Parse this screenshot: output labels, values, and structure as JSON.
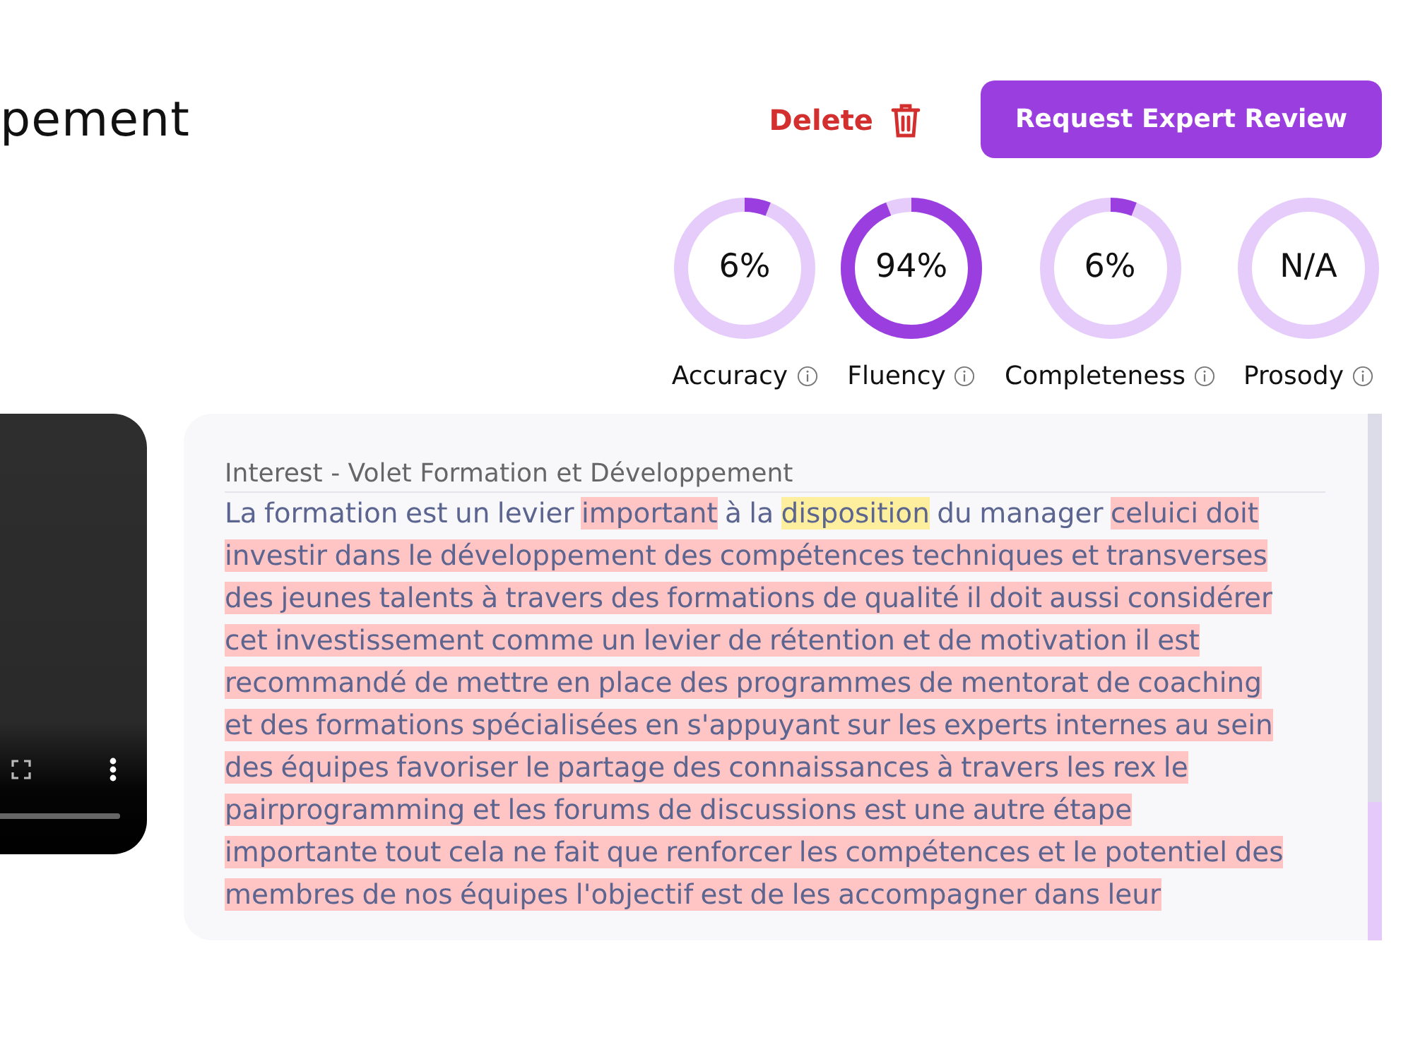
{
  "header": {
    "title": "pement",
    "delete_label": "Delete",
    "review_button": "Request Expert Review"
  },
  "scores": [
    {
      "label": "Accuracy",
      "value": "6%",
      "level": 0.06
    },
    {
      "label": "Fluency",
      "value": "94%",
      "level": 0.94
    },
    {
      "label": "Completeness",
      "value": "6%",
      "level": 0.06
    },
    {
      "label": "Prosody",
      "value": "N/A"
    }
  ],
  "video": {
    "level": 1
  },
  "transcript": {
    "title": "Interest - Volet Formation et Développement",
    "lines": [
      [
        {
          "kind": "plain",
          "text": "La formation est un levier "
        },
        {
          "kind": "error",
          "text": "important"
        },
        {
          "kind": "plain",
          "text": " à la "
        },
        {
          "kind": "warning",
          "text": "disposition"
        },
        {
          "kind": "plain",
          "text": " du manager "
        },
        {
          "kind": "error",
          "text": "celuici doit"
        }
      ],
      [
        {
          "kind": "error",
          "text": "investir dans le développement des compétences techniques et transverses"
        }
      ],
      [
        {
          "kind": "error",
          "text": "des jeunes talents à travers des formations de qualité il doit aussi considérer"
        }
      ],
      [
        {
          "kind": "error",
          "text": "cet investissement comme un levier de rétention et de motivation il est"
        }
      ],
      [
        {
          "kind": "error",
          "text": "recommandé de mettre en place des programmes de mentorat de coaching"
        }
      ],
      [
        {
          "kind": "error",
          "text": "et des formations spécialisées en s'appuyant sur les experts internes au sein"
        }
      ],
      [
        {
          "kind": "error",
          "text": "des équipes favoriser le partage des connaissances à travers les rex le"
        }
      ],
      [
        {
          "kind": "error",
          "text": "pairprogramming et les forums de discussions est une autre étape"
        }
      ],
      [
        {
          "kind": "error",
          "text": "importante tout cela ne fait que renforcer les compétences et le potentiel des"
        }
      ],
      [
        {
          "kind": "error",
          "text": "membres de nos équipes l'objectif est de les accompagner dans leur"
        }
      ]
    ]
  }
}
